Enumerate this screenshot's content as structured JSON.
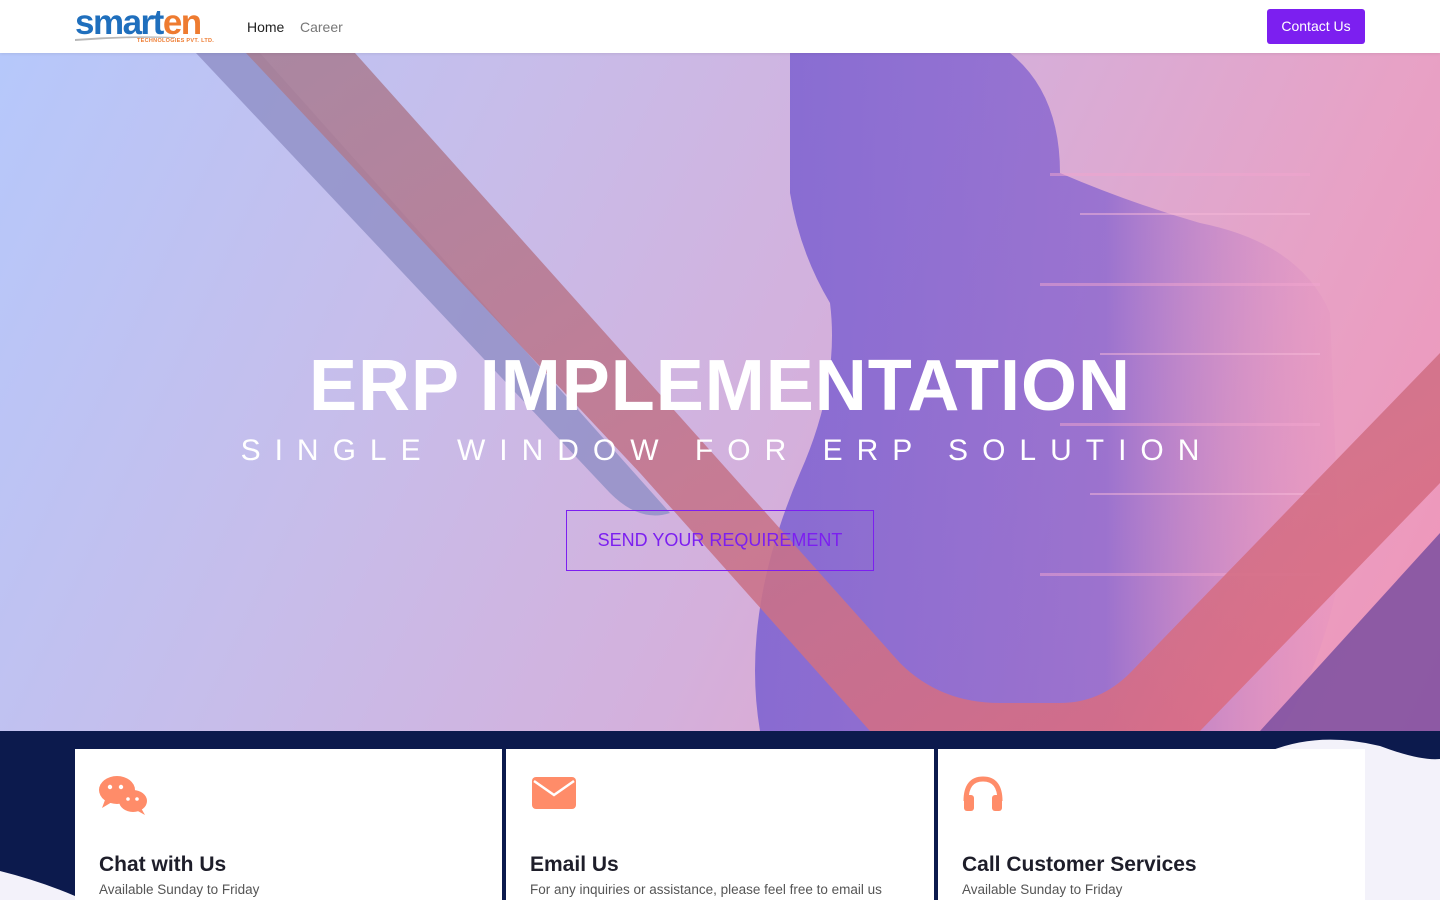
{
  "nav": {
    "logo": {
      "main_blue": "smart",
      "main_orange": "en",
      "tagline": "TECHNOLOGIES PVT. LTD."
    },
    "links": [
      {
        "label": "Home",
        "active": true
      },
      {
        "label": "Career",
        "active": false
      }
    ],
    "contact_label": "Contact Us"
  },
  "hero": {
    "title": "ERP IMPLEMENTATION",
    "subtitle": "SINGLE WINDOW FOR ERP SOLUTION",
    "cta_label": "SEND YOUR REQUIREMENT"
  },
  "cards": [
    {
      "icon": "chat-bubbles-icon",
      "title": "Chat with Us",
      "text": "Available Sunday to Friday"
    },
    {
      "icon": "envelope-icon",
      "title": "Email Us",
      "text": "For any inquiries or assistance, please feel free to email us"
    },
    {
      "icon": "headphones-icon",
      "title": "Call Customer Services",
      "text": "Available Sunday to Friday"
    }
  ],
  "colors": {
    "accent": "#7c1ff0",
    "logo_blue": "#1f6fbd",
    "logo_orange": "#ee7b30",
    "icon_orange": "#ff8c69",
    "footer_navy": "#0c1a4d"
  }
}
